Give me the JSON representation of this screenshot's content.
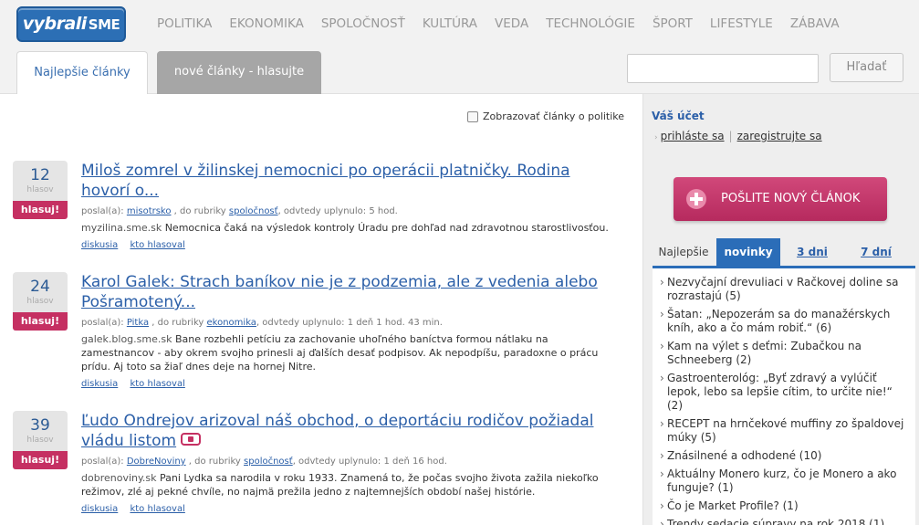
{
  "header": {
    "logo_main": "vybrali",
    "logo_sub": "SME",
    "nav": [
      "POLITIKA",
      "EKONOMIKA",
      "SPOLOČNOSŤ",
      "KULTÚRA",
      "VEDA",
      "TECHNOLÓGIE",
      "ŠPORT",
      "LIFESTYLE",
      "ZÁBAVA"
    ],
    "tab_best": "Najlepšie články",
    "tab_new": "nové články - hlasujte",
    "search_value": "",
    "search_button": "Hľadať"
  },
  "filter": {
    "label": "Zobrazovať články o politike"
  },
  "articles": [
    {
      "votes": "12",
      "votes_label": "hlasov",
      "vote_button": "hlasuj!",
      "title": "Miloš zomrel v žilinskej nemocnici po operácii platničky. Rodina hovorí o...",
      "meta_prefix": "poslal(a): ",
      "author": "misotrsko",
      "meta_mid": " , do rubriky ",
      "category": "spoločnosť",
      "meta_suffix": ", odvtedy uplynulo: 5 hod.",
      "source": "myzilina.sme.sk",
      "description": " Nemocnica čaká na výsledok kontroly Úradu pre dohľad nad zdravotnou starostlivosťou.",
      "link_discussion": "diskusia",
      "link_voters": "kto hlasoval"
    },
    {
      "votes": "24",
      "votes_label": "hlasov",
      "vote_button": "hlasuj!",
      "title": "Karol Galek: Strach baníkov nie je z podzemia, ale z vedenia alebo Pošramotený...",
      "meta_prefix": "poslal(a): ",
      "author": "Pitka",
      "meta_mid": " , do rubriky ",
      "category": "ekonomika",
      "meta_suffix": ", odvtedy uplynulo: 1 deň 1 hod. 43 min.",
      "source": "galek.blog.sme.sk",
      "description": " Bane rozbehli petíciu za zachovanie uhoľného baníctva formou nátlaku na zamestnancov - aby okrem svojho prinesli aj ďalších desať podpisov. Ak nepodpíšu, paradoxne o prácu prídu. Aj toto sa žiaľ dnes deje na hornej Nitre.",
      "link_discussion": "diskusia",
      "link_voters": "kto hlasoval"
    },
    {
      "votes": "39",
      "votes_label": "hlasov",
      "vote_button": "hlasuj!",
      "title": "Ľudo Ondrejov arizoval náš obchod, o deportáciu rodičov požiadal vládu listom",
      "meta_prefix": "poslal(a): ",
      "author": "DobreNoviny",
      "meta_mid": " , do rubriky ",
      "category": "spoločnosť",
      "meta_suffix": ", odvtedy uplynulo: 1 deň 16 hod.",
      "source": "dobrenoviny.sk",
      "description": " Pani Lydka sa narodila v roku 1933. Znamená to, že počas svojho života zažila niekoľko režimov, zlé aj pekné chvíle, no najmä prežila jedno z najtemnejších období našej histórie.",
      "link_discussion": "diskusia",
      "link_voters": "kto hlasoval"
    }
  ],
  "sidebar": {
    "account_title": "Váš účet",
    "login": "prihláste sa",
    "register": "zaregistrujte sa",
    "send_button": "POŠLITE NOVÝ ČLÁNOK",
    "tabs": [
      "Najlepšie",
      "novinky",
      "3 dni",
      "7 dní"
    ],
    "items": [
      "Nezvyčajní drevuliaci v Račkovej doline sa rozrastajú (5)",
      "Šatan: „Nepozerám sa do manažérskych kníh, ako a čo mám robiť.“ (6)",
      "Kam na výlet s deťmi: Zubačkou na Schneeberg (2)",
      "Gastroenterológ: „Byť zdravý a vylúčiť lepok, lebo sa lepšie cítim, to určite nie!“ (2)",
      "RECEPT na hrnčekové muffiny zo špaldovej múky (5)",
      "Znásilnené a odhodené (10)",
      "Aktuálny Monero kurz, čo je Monero a ako funguje? (1)",
      "Čo je Market Profile? (1)",
      "Trendy sedacie súpravy na rok 2018 (1)"
    ]
  }
}
